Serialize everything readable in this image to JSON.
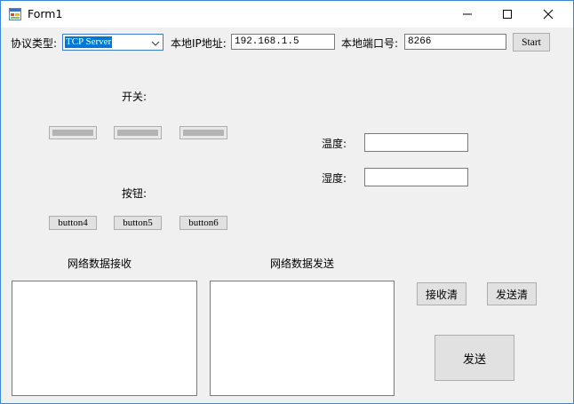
{
  "window": {
    "title": "Form1"
  },
  "connection": {
    "protocol_label": "协议类型:",
    "protocol_value": "TCP Server",
    "ip_label": "本地IP地址:",
    "ip_value": "192.168.1.5",
    "port_label": "本地端口号:",
    "port_value": "8266",
    "start_label": "Start"
  },
  "switches": {
    "label": "开关:"
  },
  "buttons": {
    "label": "按钮:",
    "items": [
      "button4",
      "button5",
      "button6"
    ]
  },
  "sensors": {
    "temperature_label": "温度:",
    "temperature_value": "",
    "humidity_label": "湿度:",
    "humidity_value": ""
  },
  "network": {
    "receive_label": "网络数据接收",
    "send_label": "网络数据发送",
    "clear_receive_label": "接收清",
    "clear_send_label": "发送清",
    "send_button_label": "发送"
  },
  "colors": {
    "accent": "#0078d7",
    "border": "#3a87d7"
  }
}
